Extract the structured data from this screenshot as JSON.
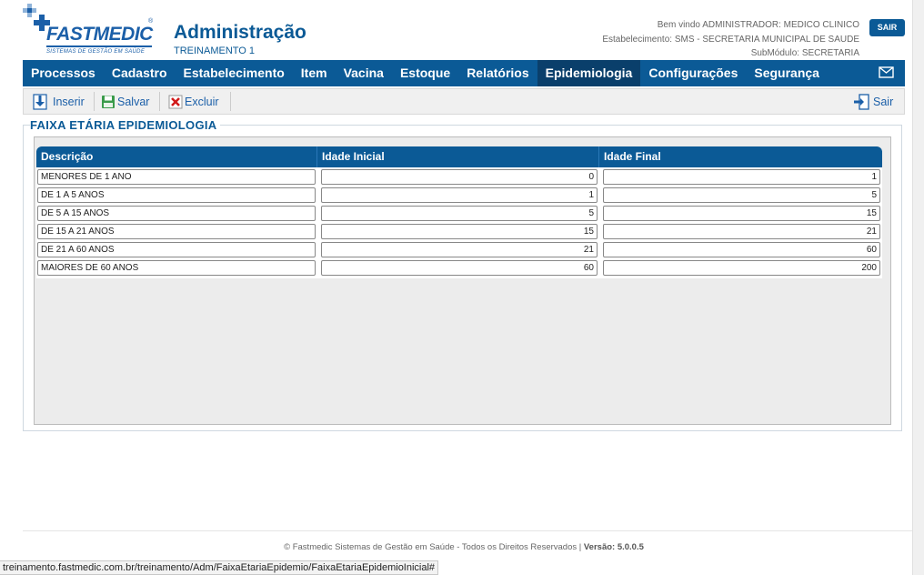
{
  "header": {
    "brand": "FASTMEDIC",
    "brand_tagline": "SISTEMAS DE GESTÃO EM SAÚDE",
    "registered_mark": "®",
    "title": "Administração",
    "subtitle": "TREINAMENTO 1",
    "welcome": "Bem vindo ADMINISTRADOR: MEDICO CLINICO",
    "establishment": "Estabelecimento: SMS - SECRETARIA MUNICIPAL DE SAUDE",
    "submodule": "SubMódulo: SECRETARIA",
    "logout_label": "SAIR"
  },
  "nav": {
    "items": [
      {
        "label": "Processos"
      },
      {
        "label": "Cadastro"
      },
      {
        "label": "Estabelecimento"
      },
      {
        "label": "Item"
      },
      {
        "label": "Vacina"
      },
      {
        "label": "Estoque"
      },
      {
        "label": "Relatórios"
      },
      {
        "label": "Epidemiologia"
      },
      {
        "label": "Configurações"
      },
      {
        "label": "Segurança"
      }
    ],
    "active": "Epidemiologia",
    "mail_icon": "envelope-icon"
  },
  "toolbar": {
    "insert_label": "Inserir",
    "save_label": "Salvar",
    "delete_label": "Excluir",
    "exit_label": "Sair"
  },
  "section": {
    "title": "FAIXA ETÁRIA EPIDEMIOLOGIA"
  },
  "grid": {
    "columns": [
      "Descrição",
      "Idade Inicial",
      "Idade Final"
    ],
    "rows": [
      {
        "descricao": "MENORES DE 1 ANO",
        "inicial": "0",
        "final": "1"
      },
      {
        "descricao": "DE 1 A 5 ANOS",
        "inicial": "1",
        "final": "5"
      },
      {
        "descricao": "DE 5 A 15 ANOS",
        "inicial": "5",
        "final": "15"
      },
      {
        "descricao": "DE 15 A 21 ANOS",
        "inicial": "15",
        "final": "21"
      },
      {
        "descricao": "DE 21 A 60 ANOS",
        "inicial": "21",
        "final": "60"
      },
      {
        "descricao": "MAIORES DE 60 ANOS",
        "inicial": "60",
        "final": "200"
      }
    ]
  },
  "footer": {
    "copyright": "© Fastmedic Sistemas de Gestão em Saúde - Todos os Direitos Reservados | ",
    "version": "Versão: 5.0.0.5"
  },
  "statusbar": {
    "url": "treinamento.fastmedic.com.br/treinamento/Adm/FaixaEtariaEpidemio/FaixaEtariaEpidemioInicial#"
  },
  "colors": {
    "primary": "#0b5a96",
    "nav_active": "#0a3f6b",
    "brand": "#1b5fa8"
  }
}
